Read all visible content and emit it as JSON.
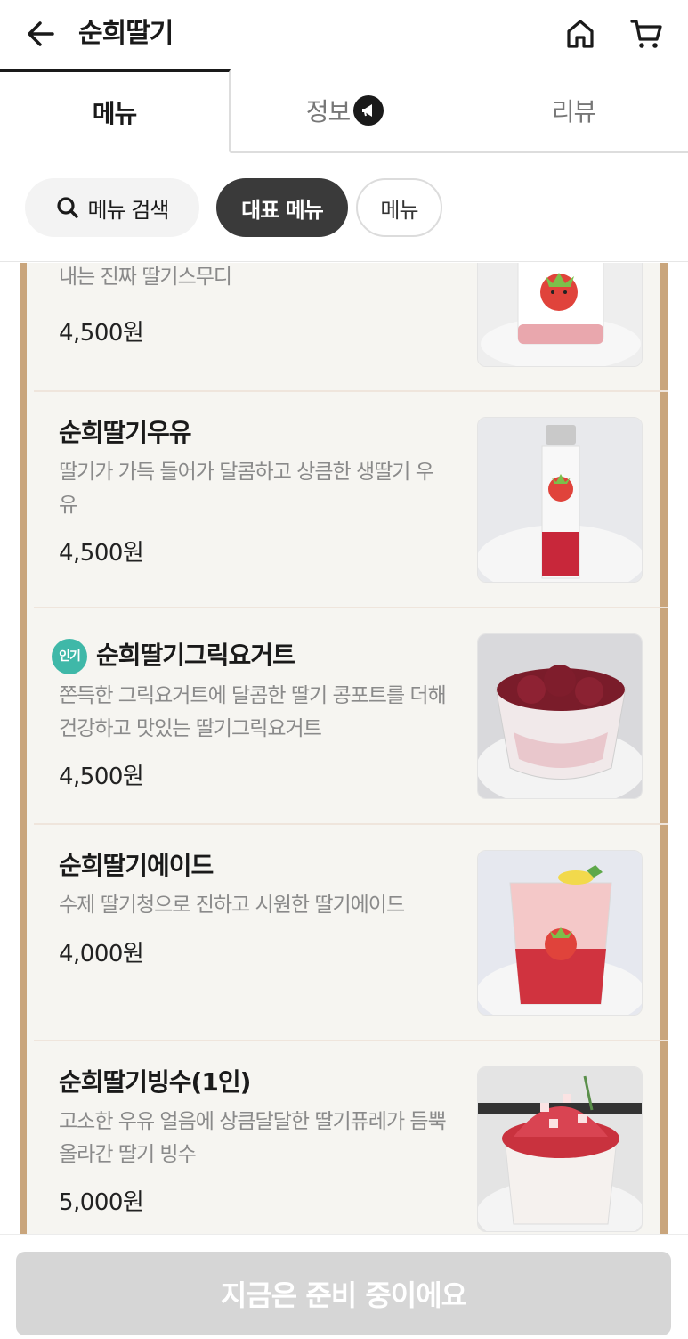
{
  "header": {
    "title": "순희딸기"
  },
  "tabs": [
    {
      "label": "메뉴",
      "active": true
    },
    {
      "label": "정보",
      "active": false
    },
    {
      "label": "리뷰",
      "active": false
    }
  ],
  "filters": {
    "search_label": "메뉴 검색",
    "rep_label": "대표 메뉴",
    "menu_label": "메뉴"
  },
  "menu_items": [
    {
      "name": "",
      "desc": "내는 진짜 딸기스무디",
      "price": "4,500원"
    },
    {
      "name": "순희딸기우유",
      "desc": "딸기가 가득 들어가 달콤하고 상큼한 생딸기 우유",
      "price": "4,500원"
    },
    {
      "name": "순희딸기그릭요거트",
      "badge": "인기",
      "desc": "쫀득한 그릭요거트에 달콤한 딸기 콩포트를 더해 건강하고 맛있는 딸기그릭요거트",
      "price": "4,500원"
    },
    {
      "name": "순희딸기에이드",
      "desc": "수제 딸기청으로  진하고 시원한 딸기에이드",
      "price": "4,000원"
    },
    {
      "name": "순희딸기빙수(1인)",
      "desc": "고소한 우유 얼음에 상큼달달한 딸기퓨레가 듬뿍 올라간 딸기 빙수",
      "price": "5,000원"
    }
  ],
  "bottom": {
    "order_label": "지금은 준비 중이에요"
  },
  "colors": {
    "accent_dark": "#3a3a3a",
    "frame": "#c9a57c",
    "badge": "#3fb8a8",
    "disabled_button": "#d6d6d6"
  }
}
